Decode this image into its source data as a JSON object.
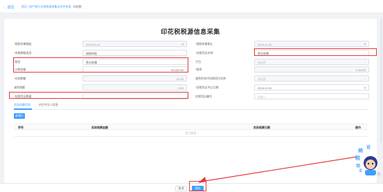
{
  "header": {
    "back_label": "返回",
    "breadcrumbs": [
      "首页",
      "财产和行为税税源采集及合并申报",
      "印花税"
    ]
  },
  "form": {
    "title": "印花税税源信息采集",
    "fields": {
      "period_start": {
        "label": "税款所属期起",
        "value": "2024-01-01"
      },
      "period_end": {
        "label": "税款所属期止",
        "value": "2024-12-31"
      },
      "declare_type": {
        "label": "申报期限类型",
        "value": "按期申报"
      },
      "item_name": {
        "label": "应税凭证名称",
        "value": "营业账簿"
      },
      "tax_item": {
        "label": "税目",
        "value": "营业账簿"
      },
      "sub_item": {
        "label": "子目",
        "value": "请选择"
      },
      "tax_basis": {
        "label": "计税金额",
        "value": "80,000.00"
      },
      "tax_rate": {
        "label": "税率",
        "value": "0.00025"
      },
      "tax_payable": {
        "label": "应纳税额",
        "value": "20.00"
      },
      "relief_code": {
        "label": "减免性质代码和项目名称",
        "value": "请选择"
      },
      "relief_amount": {
        "label": "减免税额",
        "value": "0.00"
      },
      "doc_date": {
        "label": "应税凭证书立日期",
        "value": "2024-12-31"
      },
      "doc_count": {
        "label": "应税凭证数量",
        "value": ""
      },
      "doc_no": {
        "label": "应税凭证编号",
        "value": "请输入"
      }
    },
    "tabs": [
      "实际结算信息",
      "对方书立人信息"
    ],
    "add_button": "新增行",
    "table": {
      "columns": [
        "序号",
        "实际结算金额",
        "实际结算日期",
        "操作"
      ],
      "empty_text": "暂无数据"
    }
  },
  "footer": {
    "cancel_label": "取消",
    "save_label": "保存"
  },
  "mascot": {
    "text": [
      "纳",
      "证",
      "税",
      "动",
      "E"
    ]
  },
  "colors": {
    "primary": "#409eff",
    "highlight": "#e53935"
  }
}
